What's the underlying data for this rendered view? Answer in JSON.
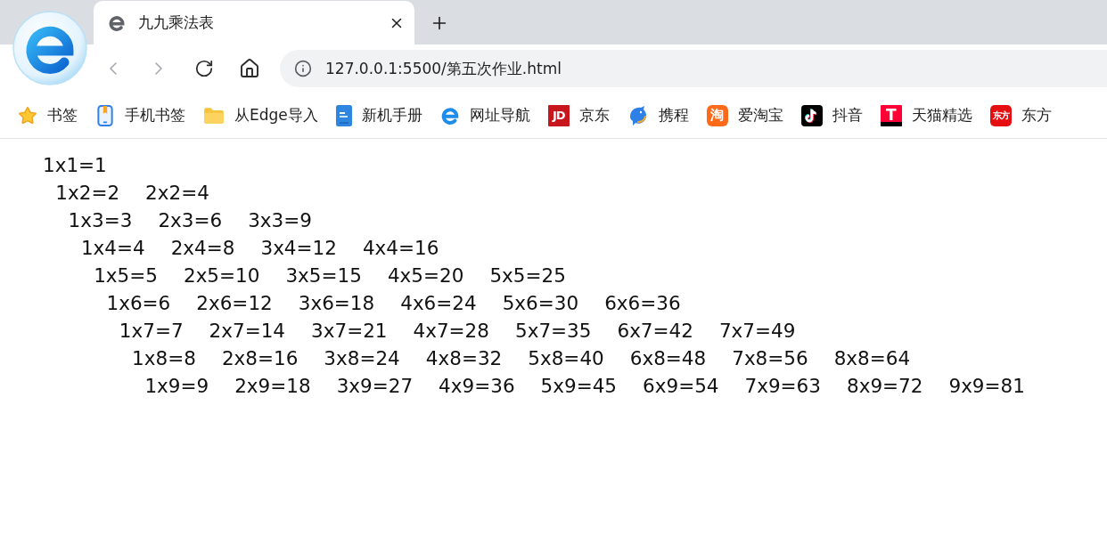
{
  "browser": {
    "tabs": [
      {
        "title": "九九乘法表",
        "selected": true
      }
    ],
    "toolbar": {
      "nav_buttons": [
        {
          "kind": "back",
          "disabled": true
        },
        {
          "kind": "forward",
          "disabled": true
        },
        {
          "kind": "reload",
          "disabled": false
        },
        {
          "kind": "home",
          "disabled": false
        }
      ],
      "address_bar": {
        "value": "127.0.0.1:5500/第五次作业.html"
      }
    },
    "bookmarks": [
      {
        "kind": "star",
        "label": "书签"
      },
      {
        "kind": "phone",
        "label": "手机书签"
      },
      {
        "kind": "folder",
        "label": "从Edge导入"
      },
      {
        "kind": "manual",
        "label": "新机手册"
      },
      {
        "kind": "e-logo",
        "label": "网址导航"
      },
      {
        "kind": "jd",
        "label": "京东",
        "logo_text": "JD"
      },
      {
        "kind": "dolphin",
        "label": "携程"
      },
      {
        "kind": "taobao",
        "label": "爱淘宝",
        "logo_text": "淘"
      },
      {
        "kind": "tiktok",
        "label": "抖音"
      },
      {
        "kind": "tmall",
        "label": "天猫精选",
        "logo_text": "T"
      },
      {
        "kind": "dongfang",
        "label": "东方",
        "logo_text": "东方"
      }
    ]
  },
  "page": {
    "rows": [
      [
        "1x1=1"
      ],
      [
        "1x2=2",
        "2x2=4"
      ],
      [
        "1x3=3",
        "2x3=6",
        "3x3=9"
      ],
      [
        "1x4=4",
        "2x4=8",
        "3x4=12",
        "4x4=16"
      ],
      [
        "1x5=5",
        "2x5=10",
        "3x5=15",
        "4x5=20",
        "5x5=25"
      ],
      [
        "1x6=6",
        "2x6=12",
        "3x6=18",
        "4x6=24",
        "5x6=30",
        "6x6=36"
      ],
      [
        "1x7=7",
        "2x7=14",
        "3x7=21",
        "4x7=28",
        "5x7=35",
        "6x7=42",
        "7x7=49"
      ],
      [
        "1x8=8",
        "2x8=16",
        "3x8=24",
        "4x8=32",
        "5x8=40",
        "6x8=48",
        "7x8=56",
        "8x8=64"
      ],
      [
        "1x9=9",
        "2x9=18",
        "3x9=27",
        "4x9=36",
        "5x9=45",
        "6x9=54",
        "7x9=63",
        "8x9=72",
        "9x9=81"
      ]
    ]
  }
}
